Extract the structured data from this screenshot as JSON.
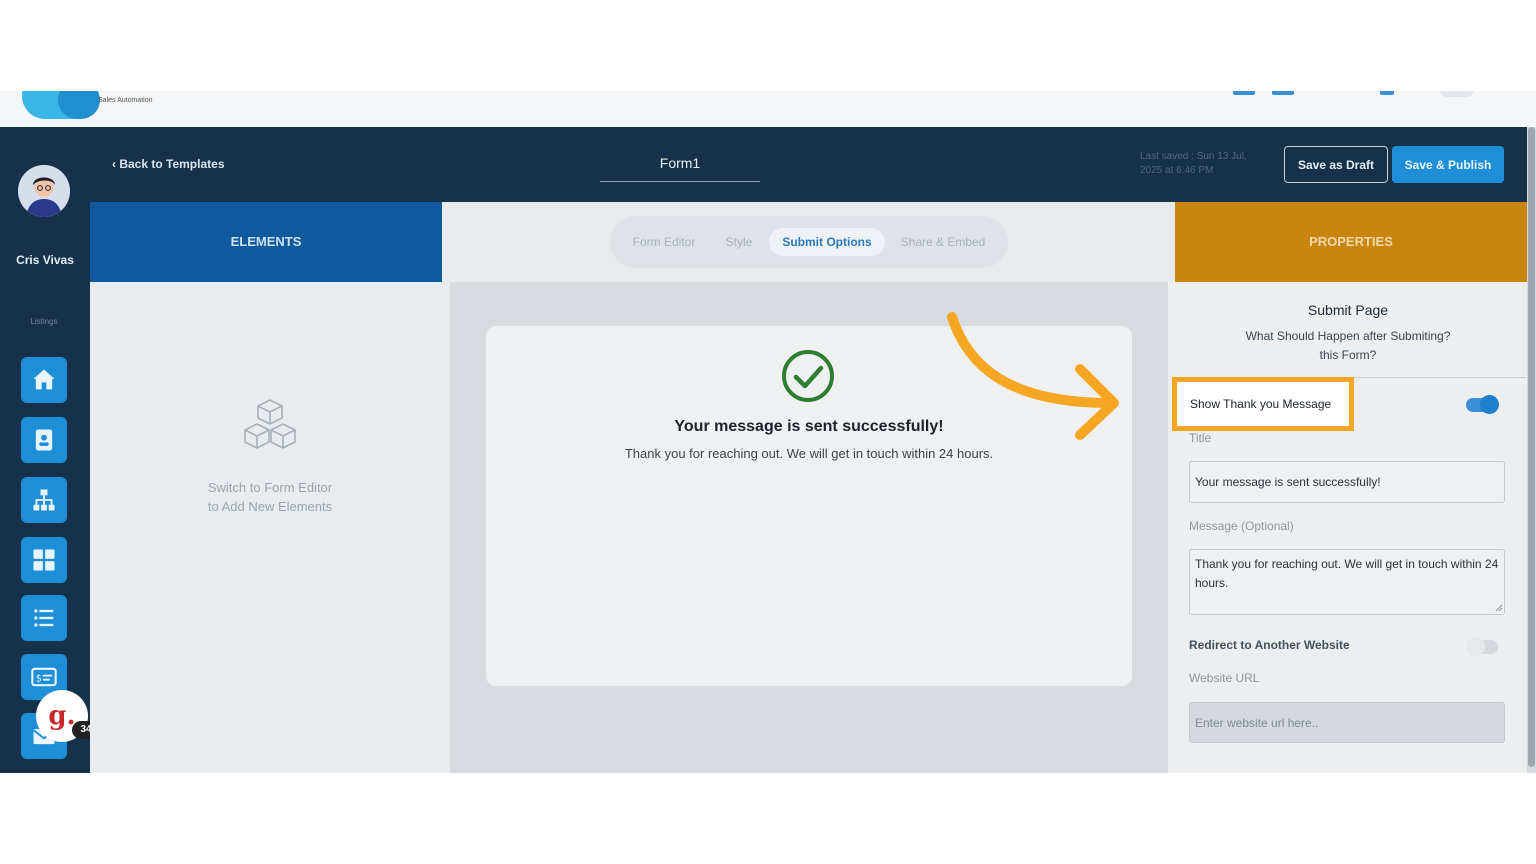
{
  "header": {
    "back_label": "Back to Templates",
    "form_name": "Form1",
    "last_saved": "Last saved : Sun 13 Jul, 2025 at 6:46 PM",
    "save_draft_label": "Save as Draft",
    "save_publish_label": "Save & Publish"
  },
  "branding": {
    "logo_subtitle": "Sales Automation"
  },
  "sidebar": {
    "user_name": "Cris Vivas",
    "section_label": "Listings",
    "items": [
      {
        "icon": "home-icon"
      },
      {
        "icon": "contact-card-icon"
      },
      {
        "icon": "org-chart-icon"
      },
      {
        "icon": "grid-icon"
      },
      {
        "icon": "list-icon"
      },
      {
        "icon": "dollar-card-icon"
      },
      {
        "icon": "mail-icon"
      }
    ],
    "badge_letter": "g.",
    "badge_count": "34"
  },
  "elements_panel": {
    "title": "ELEMENTS",
    "hint_line1": "Switch to Form Editor",
    "hint_line2": "to Add New Elements"
  },
  "tabs": [
    {
      "label": "Form Editor",
      "active": false
    },
    {
      "label": "Style",
      "active": false
    },
    {
      "label": "Submit Options",
      "active": true
    },
    {
      "label": "Share & Embed",
      "active": false
    }
  ],
  "preview": {
    "title": "Your message is sent successfully!",
    "message": "Thank you for reaching out. We will get in touch within 24 hours."
  },
  "properties": {
    "title": "PROPERTIES",
    "section_title": "Submit Page",
    "section_sub_line1": "What Should Happen after Submiting?",
    "section_sub_line2": "this Form?",
    "thank_you_label": "Show Thank you Message",
    "thank_you_enabled": true,
    "title_label": "Title",
    "title_value": "Your message is sent successfully!",
    "message_label": "Message (Optional)",
    "message_value": "Thank you for reaching out. We will get in touch within 24 hours.",
    "redirect_label": "Redirect to Another Website",
    "redirect_enabled": false,
    "url_label": "Website URL",
    "url_placeholder": "Enter website url here.."
  },
  "colors": {
    "header_bg": "#16324a",
    "accent_blue": "#1e8fd6",
    "properties_header": "#c9860e",
    "highlight": "#f5a623",
    "success_green": "#2e7d32"
  }
}
